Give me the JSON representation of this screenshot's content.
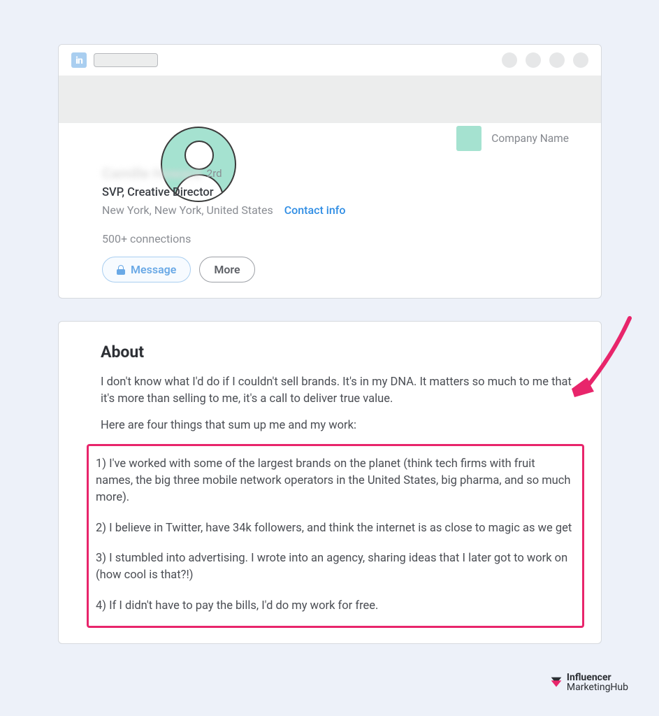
{
  "header": {
    "logo_text": "in",
    "search_placeholder": ""
  },
  "profile": {
    "name_blurred": "Camille Howard",
    "degree": "2rd",
    "title": "SVP, Creative Director",
    "location": "New York, New York, United States",
    "contact_info": "Contact info",
    "connections": "500+ connections",
    "buttons": {
      "message": "Message",
      "more": "More"
    },
    "company": {
      "label": "Company Name"
    }
  },
  "about": {
    "heading": "About",
    "intro1": "I don't know what I'd do if I couldn't sell brands. It's in my DNA. It matters so much to me that it's more than selling to me, it's a call to deliver true value.",
    "intro2": "Here are four things that sum up me and my work:",
    "points": [
      "1) I've worked with some of the largest brands on the planet (think tech firms with fruit names, the big three mobile network operators in the United States, big pharma, and so much more).",
      "2) I believe in Twitter, have 34k followers, and think the internet is as close to magic as we get",
      "3) I stumbled into advertising. I wrote into an agency, sharing ideas that I later got to work on (how cool is that?!)",
      "4) If I didn't have to pay the bills, I'd do my work for free."
    ]
  },
  "watermark": {
    "line1": "Influencer",
    "line2": "MarketingHub"
  },
  "annotation": {
    "highlight_color": "#e8256b"
  }
}
